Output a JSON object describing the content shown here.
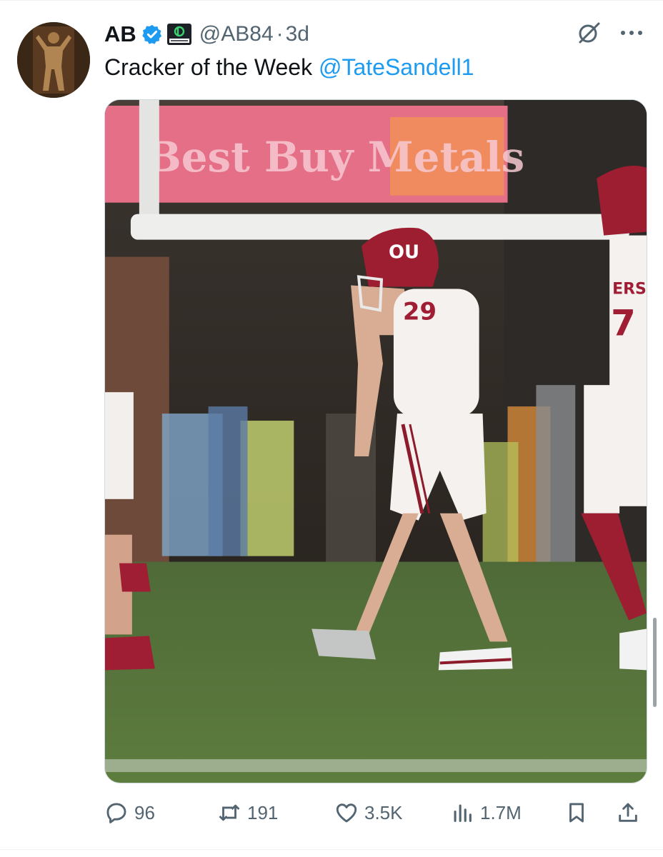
{
  "tweet": {
    "author": {
      "display_name": "AB",
      "verified": true,
      "affiliate": "BC.GAME"
    },
    "handle": "@AB84",
    "separator": "·",
    "age": "3d",
    "text_main": "Cracker of the Week",
    "mention": "@TateSandell1",
    "media": {
      "banner_text": "Best Buy Metals",
      "player_number": "29",
      "helmet_logo": "OU",
      "right_player_number": "7",
      "right_player_text": "ERS"
    }
  },
  "actions": {
    "replies": "96",
    "reposts": "191",
    "likes": "3.5K",
    "views": "1.7M"
  },
  "colors": {
    "accent": "#1d9bf0",
    "muted": "#536471",
    "crimson": "#8c1c2b"
  },
  "icons": [
    "verified-badge-icon",
    "bc-game-affiliate-icon",
    "grok-icon",
    "more-icon",
    "reply-icon",
    "repost-icon",
    "like-icon",
    "views-icon",
    "bookmark-icon",
    "share-icon"
  ]
}
